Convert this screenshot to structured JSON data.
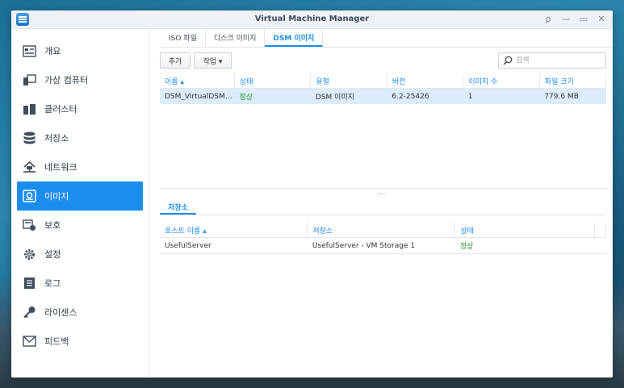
{
  "window": {
    "title": "Virtual Machine Manager"
  },
  "title_buttons": {
    "pin": "⍴",
    "minimize": "—",
    "maximize": "▭",
    "close": "✕"
  },
  "sidebar": {
    "items": [
      {
        "label": "개요",
        "icon": "overview-icon"
      },
      {
        "label": "가상 컴퓨터",
        "icon": "virtual-machine-icon"
      },
      {
        "label": "클러스터",
        "icon": "cluster-icon"
      },
      {
        "label": "저장소",
        "icon": "storage-icon"
      },
      {
        "label": "네트워크",
        "icon": "network-icon"
      },
      {
        "label": "이미지",
        "icon": "image-icon",
        "active": true
      },
      {
        "label": "보호",
        "icon": "protection-icon"
      },
      {
        "label": "설정",
        "icon": "gear-icon"
      },
      {
        "label": "로그",
        "icon": "log-icon"
      },
      {
        "label": "라이센스",
        "icon": "key-icon"
      },
      {
        "label": "피드백",
        "icon": "mail-icon"
      }
    ]
  },
  "tabs": [
    {
      "label": "ISO 파일"
    },
    {
      "label": "디스크 이미지"
    },
    {
      "label": "DSM 이미지",
      "active": true
    }
  ],
  "toolbar": {
    "add_label": "추가",
    "action_label": "작업 ▾",
    "search_placeholder": "검색"
  },
  "images_table": {
    "columns": [
      "이름 ▴",
      "상태",
      "유형",
      "버전",
      "이미지 수",
      "파일 크기"
    ],
    "rows": [
      [
        "DSM_VirtualDSM…",
        "정상",
        "DSM 이미지",
        "6.2-25426",
        "1",
        "779.6 MB"
      ]
    ]
  },
  "sub_tabs": [
    {
      "label": "저장소",
      "active": true
    }
  ],
  "storage_table": {
    "columns": [
      "호스트 이름 ▴",
      "저장소",
      "상태"
    ],
    "rows": [
      [
        "UsefulServer",
        "UsefulServer - VM Storage 1",
        "정상"
      ]
    ]
  },
  "colors": {
    "accent": "#1a8dee",
    "ok": "#2a9a2a",
    "selected_row": "#dbecfb"
  }
}
